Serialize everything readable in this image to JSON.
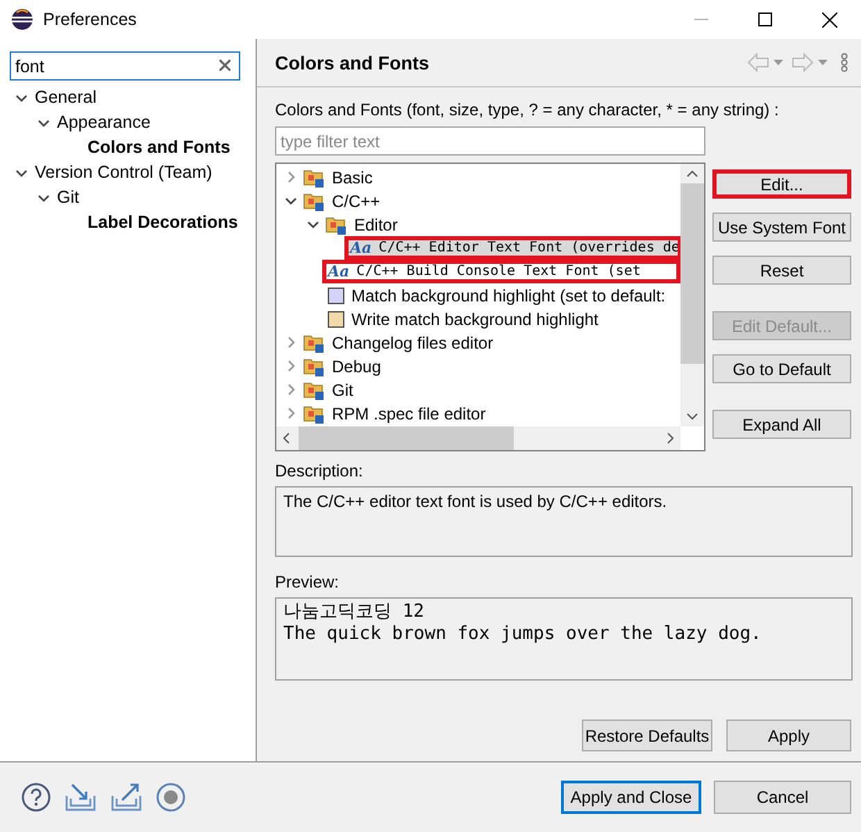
{
  "window": {
    "title": "Preferences"
  },
  "sidebar": {
    "search": {
      "value": "font"
    },
    "tree": [
      {
        "kind": "folder",
        "label": "General",
        "expanded": true,
        "children": [
          {
            "kind": "folder",
            "label": "Appearance",
            "expanded": true,
            "children": [
              {
                "kind": "leaf",
                "label": "Colors and Fonts",
                "matched": true
              }
            ]
          }
        ]
      },
      {
        "kind": "folder",
        "label": "Version Control (Team)",
        "expanded": true,
        "children": [
          {
            "kind": "folder",
            "label": "Git",
            "expanded": true,
            "children": [
              {
                "kind": "leaf",
                "label": "Label Decorations",
                "matched": true
              }
            ]
          }
        ]
      }
    ]
  },
  "page": {
    "title": "Colors and Fonts",
    "intro": "Colors and Fonts (font, size, type, ? = any character, * = any string) :",
    "filter": {
      "placeholder": "type filter text"
    },
    "tree": [
      {
        "kind": "category",
        "label": "Basic",
        "expanded": false
      },
      {
        "kind": "category",
        "label": "C/C++",
        "expanded": true,
        "children": [
          {
            "kind": "category",
            "label": "Editor",
            "expanded": true,
            "children": [
              {
                "kind": "font",
                "icon": "Aa",
                "label": "C/C++ Editor Text Font (overrides de",
                "selected": true,
                "highlighted": true
              }
            ]
          },
          {
            "kind": "font",
            "icon": "Aa",
            "label": "C/C++ Build Console Text Font (set",
            "selected": false,
            "highlighted": true
          },
          {
            "kind": "color",
            "label": "Match background highlight (set to default:",
            "color": "#d4d2f6"
          },
          {
            "kind": "color",
            "label": "Write match background highlight",
            "color": "#f2d9aa"
          }
        ]
      },
      {
        "kind": "category",
        "label": "Changelog files editor",
        "expanded": false
      },
      {
        "kind": "category",
        "label": "Debug",
        "expanded": false
      },
      {
        "kind": "category",
        "label": "Git",
        "expanded": false
      },
      {
        "kind": "category",
        "label": "RPM .spec file editor",
        "expanded": false
      }
    ],
    "button_groups": [
      [
        {
          "label": "Edit...",
          "disabled": false,
          "highlighted": true
        },
        {
          "label": "Use System Font",
          "disabled": false,
          "highlighted": false
        },
        {
          "label": "Reset",
          "disabled": false,
          "highlighted": false
        }
      ],
      [
        {
          "label": "Edit Default...",
          "disabled": true,
          "highlighted": false
        },
        {
          "label": "Go to Default",
          "disabled": false,
          "highlighted": false
        }
      ],
      [
        {
          "label": "Expand All",
          "disabled": false,
          "highlighted": false
        }
      ]
    ],
    "description_label": "Description:",
    "description": "The C/C++ editor text font is used by C/C++ editors.",
    "preview_label": "Preview:",
    "preview": [
      "나눔고딕코딩 12",
      "The quick brown fox jumps over the lazy dog."
    ],
    "actions": [
      {
        "label": "Restore Defaults"
      },
      {
        "label": "Apply"
      }
    ]
  },
  "footer": {
    "buttons": [
      {
        "label": "Apply and Close",
        "default": true
      },
      {
        "label": "Cancel",
        "default": false
      }
    ]
  }
}
